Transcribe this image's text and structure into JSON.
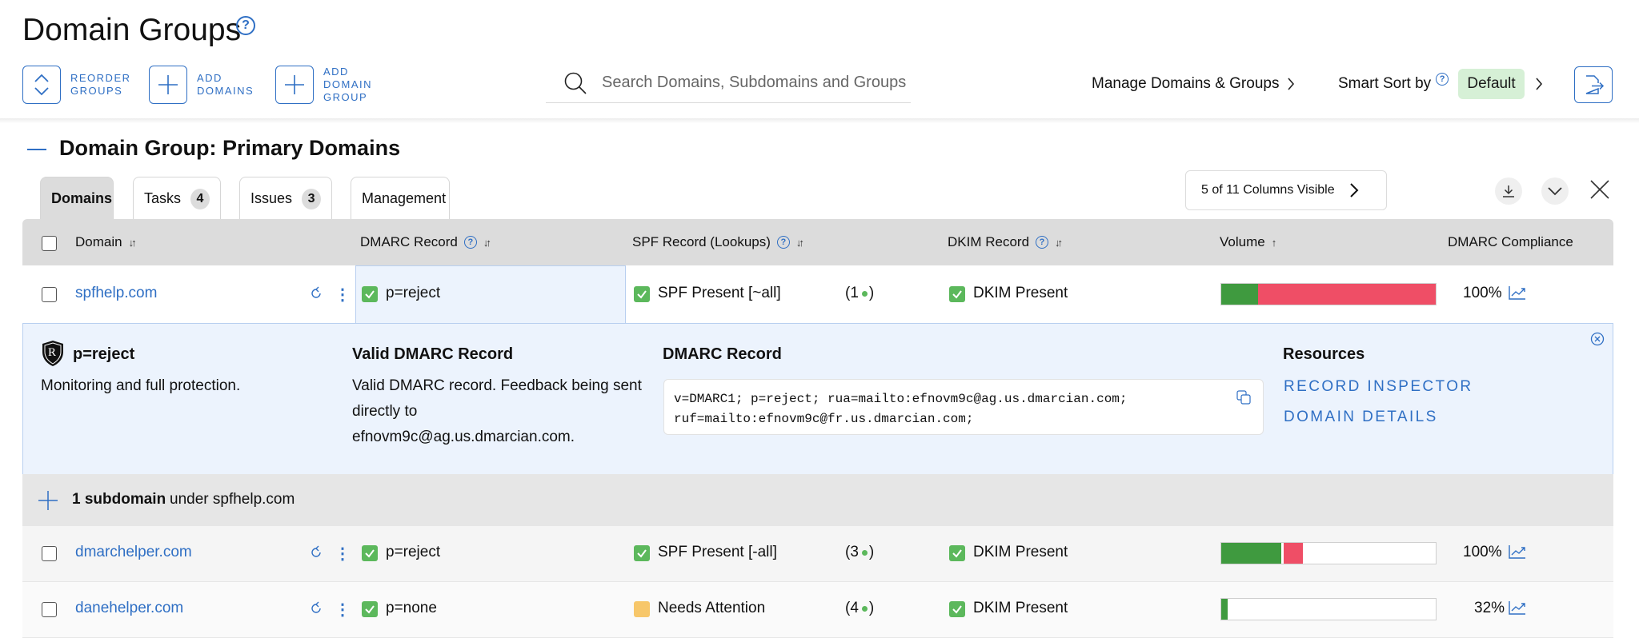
{
  "header": {
    "title": "Domain Groups",
    "help": "?",
    "toolbar": {
      "reorder": "REORDER GROUPS",
      "reorder_l1": "REORDER",
      "reorder_l2": "GROUPS",
      "add_domains_l1": "ADD",
      "add_domains_l2": "DOMAINS",
      "add_group_l1": "ADD",
      "add_group_l2": "DOMAIN",
      "add_group_l3": "GROUP"
    },
    "search_placeholder": "Search Domains, Subdomains and Groups",
    "manage_label": "Manage Domains & Groups",
    "smart_sort_label": "Smart Sort by",
    "smart_sort_value": "Default"
  },
  "group": {
    "title": "Domain Group: Primary Domains",
    "tabs": [
      {
        "label": "Domains",
        "badge": ""
      },
      {
        "label": "Tasks",
        "badge": "4"
      },
      {
        "label": "Issues",
        "badge": "3"
      },
      {
        "label": "Management",
        "badge": ""
      }
    ],
    "columns_visible": "5 of 11 Columns Visible"
  },
  "table": {
    "headers": {
      "domain": "Domain",
      "dmarc": "DMARC Record",
      "spf": "SPF Record (Lookups)",
      "dkim": "DKIM Record",
      "volume": "Volume",
      "compliance": "DMARC Compliance"
    },
    "rows": [
      {
        "domain": "spfhelp.com",
        "dmarc": "p=reject",
        "spf": "SPF Present [~all]",
        "lookups_open": "(1",
        "lookups_close": ")",
        "dkim": "DKIM Present",
        "vol_green": 0.17,
        "vol_red": 0.83,
        "compliance": "100%"
      },
      {
        "domain": "dmarchelper.com",
        "dmarc": "p=reject",
        "spf": "SPF Present [-all]",
        "lookups_open": "(3",
        "lookups_close": ")",
        "dkim": "DKIM Present",
        "vol_green": 0.28,
        "vol_red": 0.09,
        "compliance": "100%"
      },
      {
        "domain": "danehelper.com",
        "dmarc": "p=none",
        "spf": "Needs Attention",
        "lookups_open": "(4",
        "lookups_close": ")",
        "dkim": "DKIM Present",
        "vol_green": 0.03,
        "vol_red": 0,
        "compliance": "32%"
      }
    ],
    "subdomain": {
      "count_label": "1 subdomain",
      "under_label": "under spfhelp.com"
    }
  },
  "detail": {
    "badge_letter": "R",
    "policy": "p=reject",
    "policy_desc": "Monitoring and full protection.",
    "valid_title": "Valid DMARC Record",
    "valid_desc_l1": "Valid DMARC record. Feedback being sent",
    "valid_desc_l2": "directly to",
    "valid_desc_l3": "efnovm9c@ag.us.dmarcian.com.",
    "record_title": "DMARC Record",
    "record_l1": "v=DMARC1; p=reject; rua=mailto:efnovm9c@ag.us.dmarcian.com;",
    "record_l2": "ruf=mailto:efnovm9c@fr.us.dmarcian.com;",
    "resources_title": "Resources",
    "link_inspector": "RECORD INSPECTOR",
    "link_details": "DOMAIN DETAILS"
  },
  "colors": {
    "accent": "#2f6fc4",
    "green": "#3f9a3f",
    "red": "#ef4e66",
    "amber": "#f7c76a"
  }
}
